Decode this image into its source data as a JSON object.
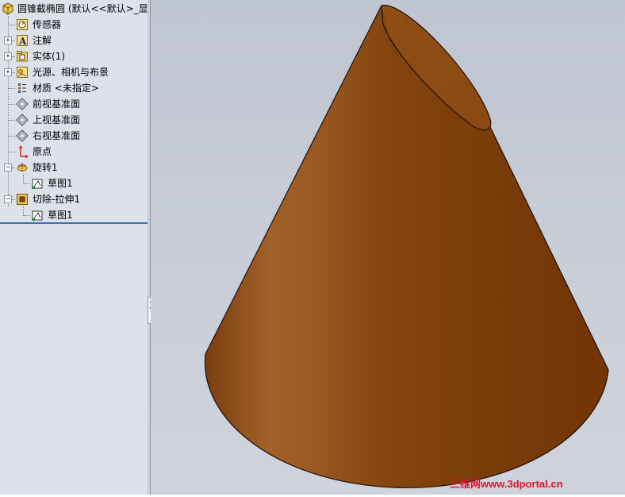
{
  "feature_tree": {
    "root_label": "圆锥截椭圆 (默认<<默认>_显",
    "items": [
      {
        "label": "传感器",
        "icon": "sensor-icon"
      },
      {
        "label": "注解",
        "icon": "annotation-icon",
        "expandable": true
      },
      {
        "label": "实体(1)",
        "icon": "solid-body-folder-icon",
        "expandable": true
      },
      {
        "label": "光源、相机与布景",
        "icon": "lights-camera-scene-icon",
        "expandable": true
      },
      {
        "label": "材质 <未指定>",
        "icon": "material-icon"
      },
      {
        "label": "前视基准面",
        "icon": "plane-icon"
      },
      {
        "label": "上视基准面",
        "icon": "plane-icon"
      },
      {
        "label": "右视基准面",
        "icon": "plane-icon"
      },
      {
        "label": "原点",
        "icon": "origin-icon"
      },
      {
        "label": "旋转1",
        "icon": "revolve-icon",
        "expandable": true,
        "expanded": true
      },
      {
        "label": "草图1",
        "icon": "sketch-icon",
        "child": true
      },
      {
        "label": "切除-拉伸1",
        "icon": "cut-extrude-icon",
        "expandable": true,
        "expanded": true
      },
      {
        "label": "草图1",
        "icon": "sketch-icon",
        "child": true
      }
    ]
  },
  "viewport": {
    "model": "truncated-cone",
    "model_color": "#8a4a14"
  },
  "watermark": "三维网www.3dportal.cn"
}
